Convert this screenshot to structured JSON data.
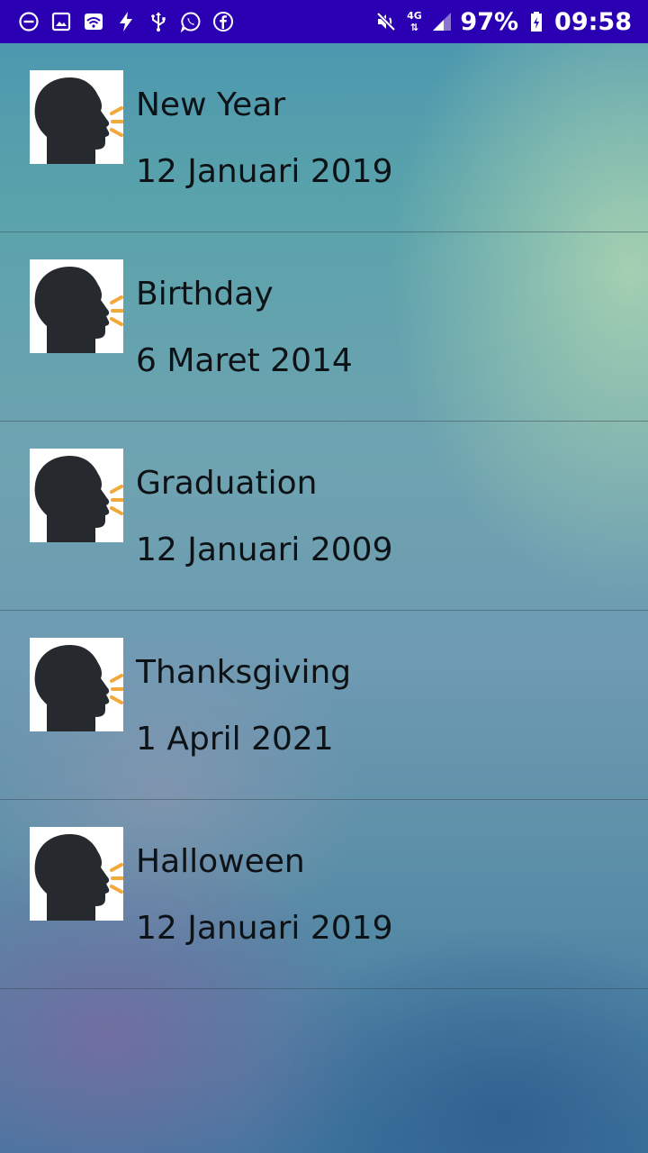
{
  "status_bar": {
    "left_icons": [
      "do-not-disturb-icon",
      "gallery-icon",
      "wifi-icon",
      "flash-icon",
      "usb-icon",
      "whatsapp-icon",
      "facebook-icon"
    ],
    "mute_icon": "mute-icon",
    "network_label": "4G",
    "signal_icon": "signal-icon",
    "battery_percent": "97%",
    "battery_icon": "battery-charging-icon",
    "time": "09:58",
    "background_color": "#2b00b3"
  },
  "events": [
    {
      "title": "New Year",
      "date": "12 Januari 2019",
      "icon": "speaking-head-icon"
    },
    {
      "title": "Birthday",
      "date": "6 Maret 2014",
      "icon": "speaking-head-icon"
    },
    {
      "title": "Graduation",
      "date": "12 Januari 2009",
      "icon": "speaking-head-icon"
    },
    {
      "title": "Thanksgiving",
      "date": "1 April 2021",
      "icon": "speaking-head-icon"
    },
    {
      "title": "Halloween",
      "date": "12 Januari 2019",
      "icon": "speaking-head-icon"
    }
  ],
  "colors": {
    "head": "#262a2f",
    "speech_lines": "#f2a83a",
    "text": "#0d1216"
  }
}
